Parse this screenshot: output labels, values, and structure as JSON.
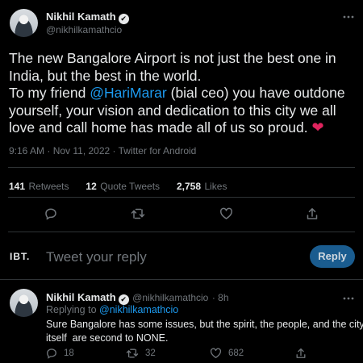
{
  "main_tweet": {
    "author_name": "Nikhil Kamath",
    "author_handle": "@nikhilkamathcio",
    "verified_mark": "✔",
    "more_icon": "more-icon",
    "text_line1": "The new Bangalore Airport is not just the best one in",
    "text_line2": "India, but the best in the world.",
    "text_line3_pre": "To my friend ",
    "text_line3_mention": "@HariMarar",
    "text_line3_post": " (bial ceo) you have outdone",
    "text_line4": "yourself, your vision and dedication to this city we all",
    "text_line5": "love and call home has made all of us so proud.",
    "heart": "❤",
    "timestamp": "9:16 AM · Nov 11, 2022 · Twitter for Android",
    "stats": {
      "retweets_count": "141",
      "retweets_label": "Retweets",
      "quotes_count": "12",
      "quotes_label": "Quote Tweets",
      "likes_count": "2,758",
      "likes_label": "Likes"
    }
  },
  "compose": {
    "logo_text": "IBT.",
    "placeholder": "Tweet your reply",
    "reply_button": "Reply"
  },
  "reply_tweet": {
    "author_name": "Nikhil Kamath",
    "author_handle": "@nikhilkamathcio",
    "time": "· 8h",
    "replying_to_label": "Replying to",
    "replying_to_handle": "@nikhilkamathcio",
    "text_line1": "Sure Bangalore has some issues, but the spirit, the people, and the city",
    "text_line2": "itself  are second to NONE.",
    "reply_count": "18",
    "retweet_count": "32",
    "like_count": "682"
  },
  "colors": {
    "background": "#000000",
    "accent": "#1d9bf0",
    "muted": "#71767b",
    "heart": "#e0245e"
  }
}
